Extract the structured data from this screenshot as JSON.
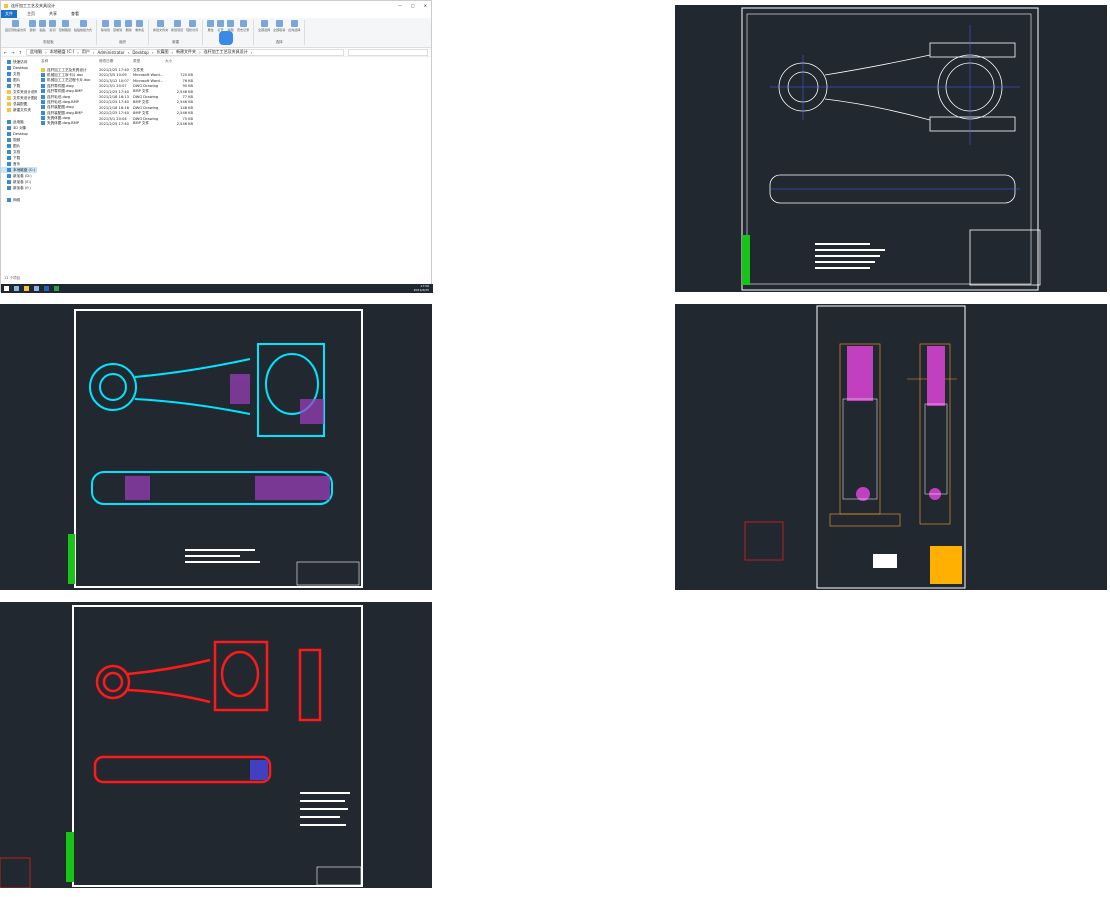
{
  "window": {
    "title": "连杆加工工艺及夹具设计"
  },
  "ribbon_tabs": [
    "文件",
    "主页",
    "共享",
    "查看"
  ],
  "ribbon_groups": [
    {
      "label": "剪贴板",
      "buttons": [
        "固定到快速访问",
        "复制",
        "粘贴",
        "剪切",
        "复制路径",
        "粘贴快捷方式"
      ]
    },
    {
      "label": "组织",
      "buttons": [
        "移动到",
        "复制到",
        "删除",
        "重命名"
      ]
    },
    {
      "label": "新建",
      "buttons": [
        "新建文件夹",
        "新建项目",
        "轻松访问"
      ]
    },
    {
      "label": "打开",
      "buttons": [
        "属性",
        "打开",
        "编辑",
        "历史记录"
      ]
    },
    {
      "label": "选择",
      "buttons": [
        "全部选择",
        "全部取消",
        "反向选择"
      ]
    }
  ],
  "address": [
    "此电脑",
    "本地磁盘 (C:)",
    "用户",
    "Administrator",
    "Desktop",
    "长篇图",
    "新建文件夹",
    "连杆加工工艺及夹具设计"
  ],
  "sidebar": [
    {
      "label": "快速访问",
      "icon": "star-icon"
    },
    {
      "label": "Desktop",
      "icon": "desktop-icon"
    },
    {
      "label": "文档",
      "icon": "document-icon"
    },
    {
      "label": "图片",
      "icon": "picture-icon"
    },
    {
      "label": "下载",
      "icon": "download-icon"
    },
    {
      "label": "文件夹设计说明书",
      "icon": "folder-icon"
    },
    {
      "label": "文件夹设计图纸",
      "icon": "folder-icon"
    },
    {
      "label": "总装配图",
      "icon": "folder-icon"
    },
    {
      "label": "新建文件夹",
      "icon": "folder-icon"
    },
    {
      "label": "此电脑",
      "icon": "computer-icon"
    },
    {
      "label": "3D 对象",
      "icon": "cube-icon"
    },
    {
      "label": "Desktop",
      "icon": "desktop-icon"
    },
    {
      "label": "视频",
      "icon": "video-icon"
    },
    {
      "label": "图片",
      "icon": "picture-icon"
    },
    {
      "label": "文档",
      "icon": "document-icon"
    },
    {
      "label": "下载",
      "icon": "download-icon"
    },
    {
      "label": "音乐",
      "icon": "music-icon"
    },
    {
      "label": "本地磁盘 (C:)",
      "icon": "drive-icon",
      "selected": true
    },
    {
      "label": "新加卷 (D:)",
      "icon": "drive-icon"
    },
    {
      "label": "新加卷 (E:)",
      "icon": "drive-icon"
    },
    {
      "label": "新加卷 (F:)",
      "icon": "drive-icon"
    },
    {
      "label": "网络",
      "icon": "network-icon"
    }
  ],
  "columns": [
    "名称",
    "修改日期",
    "类型",
    "大小"
  ],
  "files": [
    {
      "name": "连杆加工工艺及夹具设计",
      "date": "2021/2/25 17:40",
      "type": "文件夹",
      "size": "",
      "icon": "folder-icon"
    },
    {
      "name": "机械加工工序卡片.doc",
      "date": "2021/3/5 10:09",
      "type": "Microsoft Word...",
      "size": "720 KB",
      "icon": "word-icon"
    },
    {
      "name": "机械加工工艺过程卡片.doc",
      "date": "2021/3/12 10:07",
      "type": "Microsoft Word...",
      "size": "76 KB",
      "icon": "word-icon"
    },
    {
      "name": "连杆零件图.dwg",
      "date": "2021/3/1 20:07",
      "type": "DWG Drawing",
      "size": "90 KB",
      "icon": "dwg-icon"
    },
    {
      "name": "连杆零件图.dwg.BMP",
      "date": "2021/2/25 17:40",
      "type": "BMP 文件",
      "size": "2,546 KB",
      "icon": "image-icon"
    },
    {
      "name": "连杆毛坯.dwg",
      "date": "2021/2/18 16:13",
      "type": "DWG Drawing",
      "size": "77 KB",
      "icon": "dwg-icon"
    },
    {
      "name": "连杆毛坯.dwg.BMP",
      "date": "2021/2/25 17:40",
      "type": "BMP 文件",
      "size": "2,546 KB",
      "icon": "image-icon"
    },
    {
      "name": "连杆装配图.dwg",
      "date": "2021/2/18 16:16",
      "type": "DWG Drawing",
      "size": "148 KB",
      "icon": "dwg-icon"
    },
    {
      "name": "连杆装配图.dwg.BMP",
      "date": "2021/2/25 17:40",
      "type": "BMP 文件",
      "size": "2,546 KB",
      "icon": "image-icon"
    },
    {
      "name": "夹具体图.dwg",
      "date": "2021/3/1 20:04",
      "type": "DWG Drawing",
      "size": "75 KB",
      "icon": "dwg-icon"
    },
    {
      "name": "夹具体图.dwg.BMP",
      "date": "2021/2/25 17:40",
      "type": "BMP 文件",
      "size": "2,546 KB",
      "icon": "image-icon"
    }
  ],
  "status": "11 个项目",
  "tray": {
    "time": "17:56",
    "date": "2021/2/25"
  },
  "colors": {
    "cad_bg": "#212830",
    "accent": "#1a73c8",
    "cyan": "#00e5ff",
    "red": "#ff1a1a",
    "magenta": "#c040c0",
    "yellow": "#ffd000"
  }
}
